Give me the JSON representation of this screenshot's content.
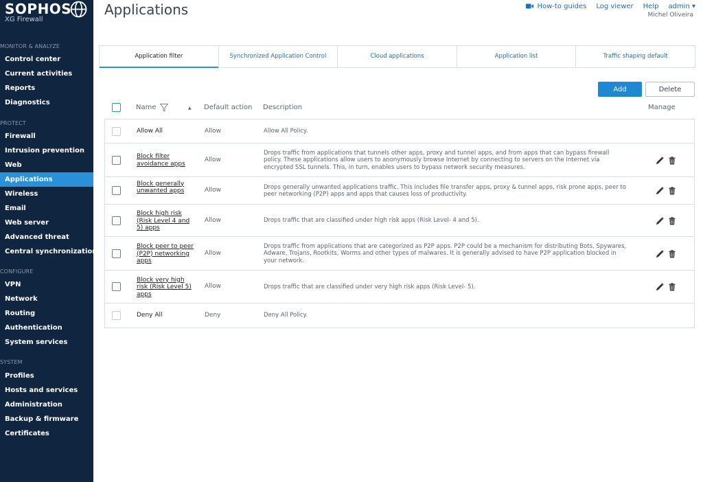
{
  "brand": {
    "logo": "SOPHOS",
    "product": "XG Firewall"
  },
  "sidebar": {
    "sections": [
      {
        "title": "MONITOR & ANALYZE",
        "items": [
          "Control center",
          "Current activities",
          "Reports",
          "Diagnostics"
        ]
      },
      {
        "title": "PROTECT",
        "items": [
          "Firewall",
          "Intrusion prevention",
          "Web",
          "Applications",
          "Wireless",
          "Email",
          "Web server",
          "Advanced threat",
          "Central synchronization"
        ]
      },
      {
        "title": "CONFIGURE",
        "items": [
          "VPN",
          "Network",
          "Routing",
          "Authentication",
          "System services"
        ]
      },
      {
        "title": "SYSTEM",
        "items": [
          "Profiles",
          "Hosts and services",
          "Administration",
          "Backup & firmware",
          "Certificates"
        ]
      }
    ],
    "active": "Applications"
  },
  "header": {
    "title": "Applications",
    "links": {
      "howto": "How-to guides",
      "log": "Log viewer",
      "help": "Help",
      "admin": "admin ▾"
    },
    "username": "Michel Oliveira"
  },
  "tabs": [
    "Application filter",
    "Synchronized Application Control",
    "Cloud applications",
    "Application list",
    "Traffic shaping default"
  ],
  "active_tab": "Application filter",
  "buttons": {
    "add": "Add",
    "delete": "Delete"
  },
  "table": {
    "headers": {
      "name": "Name",
      "action": "Default action",
      "description": "Description",
      "manage": "Manage"
    },
    "rows": [
      {
        "name": "Allow All",
        "action": "Allow",
        "description": "Allow All Policy.",
        "editable": false
      },
      {
        "name": "Block filter avoidance apps",
        "action": "Allow",
        "description": "Drops traffic from applications that tunnels other apps, proxy and tunnel apps, and from apps that can bypass firewall policy. These applications allow users to anonymously browse Internet by connecting to servers on the Internet via encrypted SSL tunnels. This, in turn, enables users to bypass network security measures.",
        "editable": true
      },
      {
        "name": "Block generally unwanted apps",
        "action": "Allow",
        "description": "Drops generally unwanted applications traffic. This includes file transfer apps, proxy & tunnel apps, risk prone apps, peer to peer networking (P2P) apps and apps that causes loss of productivity.",
        "editable": true
      },
      {
        "name": "Block high risk (Risk Level 4 and 5) apps",
        "action": "Allow",
        "description": "Drops traffic that are classified under high risk apps (Risk Level- 4 and 5).",
        "editable": true
      },
      {
        "name": "Block peer to peer (P2P) networking apps",
        "action": "Allow",
        "description": "Drops traffic from applications that are categorized as P2P apps. P2P could be a mechanism for distributing Bots, Spywares, Adware, Trojans, Rootkits, Worms and other types of malwares. It is generally advised to have P2P application blocked in your network.",
        "editable": true
      },
      {
        "name": "Block very high risk (Risk Level 5) apps",
        "action": "Allow",
        "description": "Drops traffic that are classified under very high risk apps (Risk Level- 5).",
        "editable": true
      },
      {
        "name": "Deny All",
        "action": "Deny",
        "description": "Deny All Policy.",
        "editable": false
      }
    ]
  },
  "colors": {
    "sidebar_bg": "#10253f",
    "accent": "#2a90d8",
    "link": "#1f6fb5"
  }
}
